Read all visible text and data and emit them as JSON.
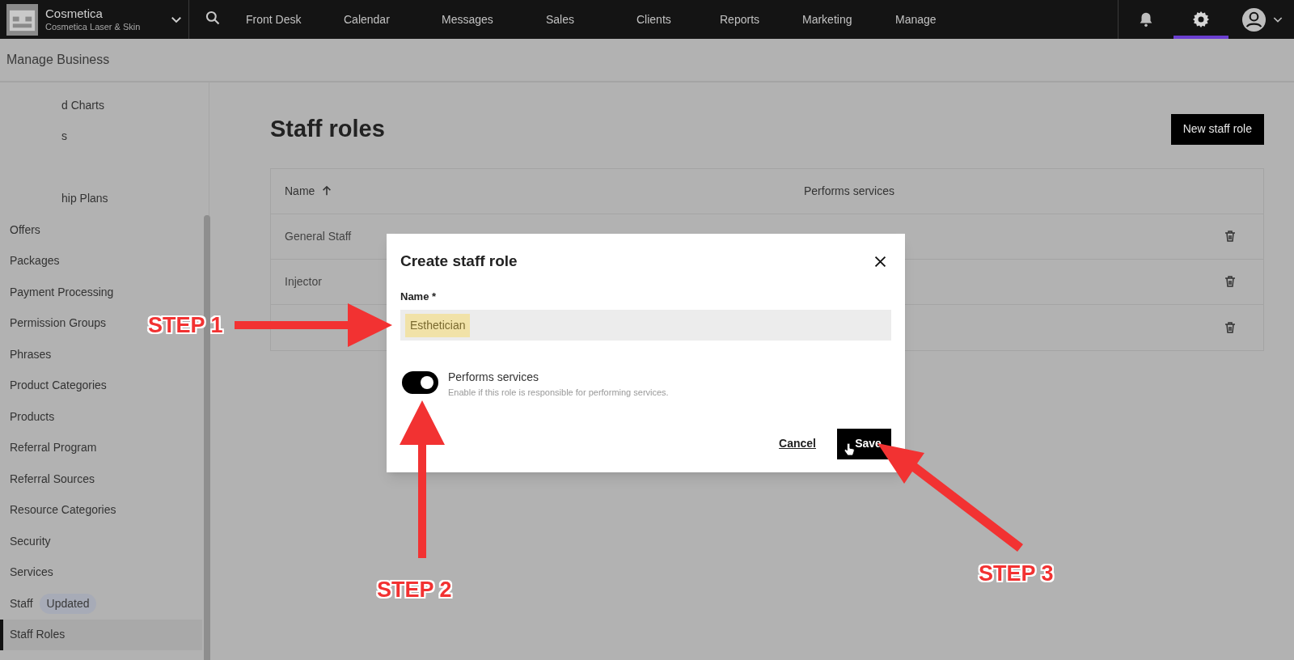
{
  "business": {
    "name": "Cosmetica",
    "location": "Cosmetica Laser & Skin"
  },
  "nav": [
    {
      "label": "Front Desk"
    },
    {
      "label": "Calendar"
    },
    {
      "label": "Messages"
    },
    {
      "label": "Sales"
    },
    {
      "label": "Clients"
    },
    {
      "label": "Reports"
    },
    {
      "label": "Marketing"
    },
    {
      "label": "Manage"
    }
  ],
  "icon_tabs": [
    {
      "kind": "bell",
      "selected": false
    },
    {
      "kind": "gear",
      "selected": true
    }
  ],
  "page_header": "Manage Business",
  "sidebar": {
    "clipped_items": [
      "d Charts",
      "s",
      "hip Plans"
    ],
    "items": [
      {
        "label": "Offers",
        "selected": false
      },
      {
        "label": "Packages",
        "selected": false
      },
      {
        "label": "Payment Processing",
        "selected": false
      },
      {
        "label": "Permission Groups",
        "selected": false
      },
      {
        "label": "Phrases",
        "selected": false
      },
      {
        "label": "Product Categories",
        "selected": false
      },
      {
        "label": "Products",
        "selected": false
      },
      {
        "label": "Referral Program",
        "selected": false
      },
      {
        "label": "Referral Sources",
        "selected": false
      },
      {
        "label": "Resource Categories",
        "selected": false
      },
      {
        "label": "Security",
        "selected": false
      },
      {
        "label": "Services",
        "selected": false
      },
      {
        "label": "Staff",
        "selected": false,
        "badge": "Updated"
      },
      {
        "label": "Staff Roles",
        "selected": true
      }
    ]
  },
  "title": "Staff roles",
  "new_button": "New staff role",
  "table": {
    "columns": [
      "Name",
      "Performs services"
    ],
    "rows": [
      {
        "name": "General Staff"
      },
      {
        "name": "Injector"
      },
      {}
    ]
  },
  "modal": {
    "title": "Create staff role",
    "name_label": "Name *",
    "name_value": "Esthetician",
    "toggle": {
      "label": "Performs services",
      "description": "Enable if this role is responsible for performing services.",
      "on": true
    },
    "cancel": "Cancel",
    "save": "Save"
  },
  "annotations": [
    {
      "label": "STEP 1"
    },
    {
      "label": "STEP 2"
    },
    {
      "label": "STEP 3"
    }
  ]
}
